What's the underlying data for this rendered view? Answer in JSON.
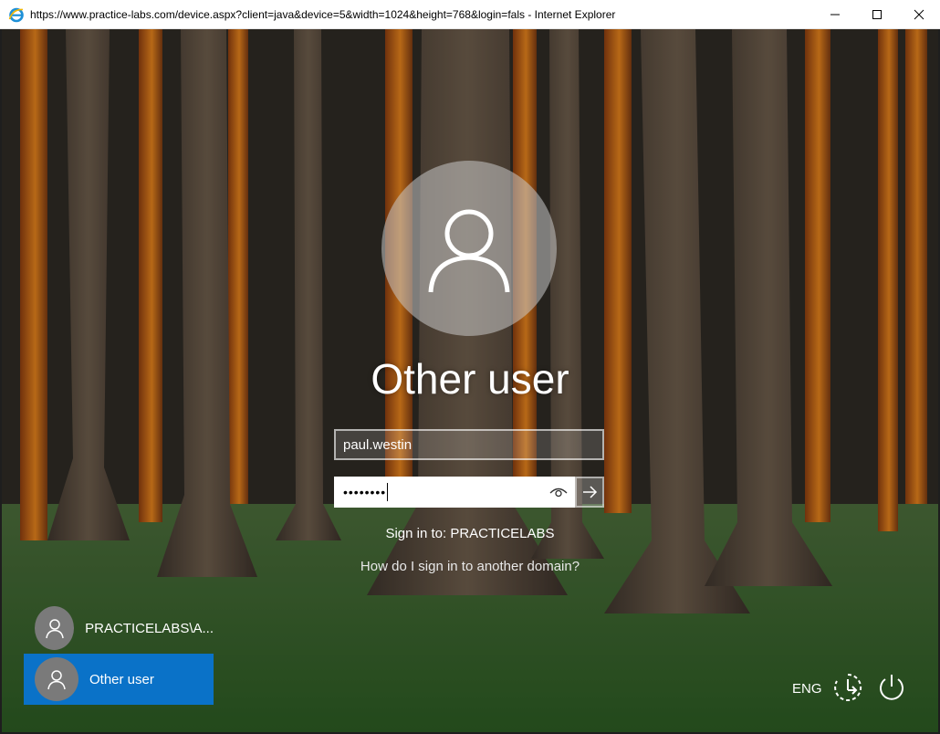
{
  "window": {
    "title": "https://www.practice-labs.com/device.aspx?client=java&device=5&width=1024&height=768&login=fals - Internet Explorer",
    "app_icon": "internet-explorer-icon",
    "controls": {
      "minimize_icon": "minimize-icon",
      "maximize_icon": "maximize-icon",
      "close_icon": "close-icon"
    }
  },
  "login": {
    "user_icon": "user-icon",
    "title": "Other user",
    "username_value": "paul.westin",
    "password_mask": "••••••••",
    "reveal_icon": "eye-icon",
    "submit_icon": "arrow-right-icon",
    "sign_in_to": "Sign in to: PRACTICELABS",
    "other_domain_link": "How do I sign in to another domain?"
  },
  "user_list": [
    {
      "label": "PRACTICELABS\\A...",
      "selected": false
    },
    {
      "label": "Other user",
      "selected": true
    }
  ],
  "tray": {
    "language": "ENG",
    "ease_of_access_icon": "ease-of-access-icon",
    "power_icon": "power-icon"
  },
  "colors": {
    "selection": "#0a72c8",
    "ie_blue": "#1e90d8"
  }
}
